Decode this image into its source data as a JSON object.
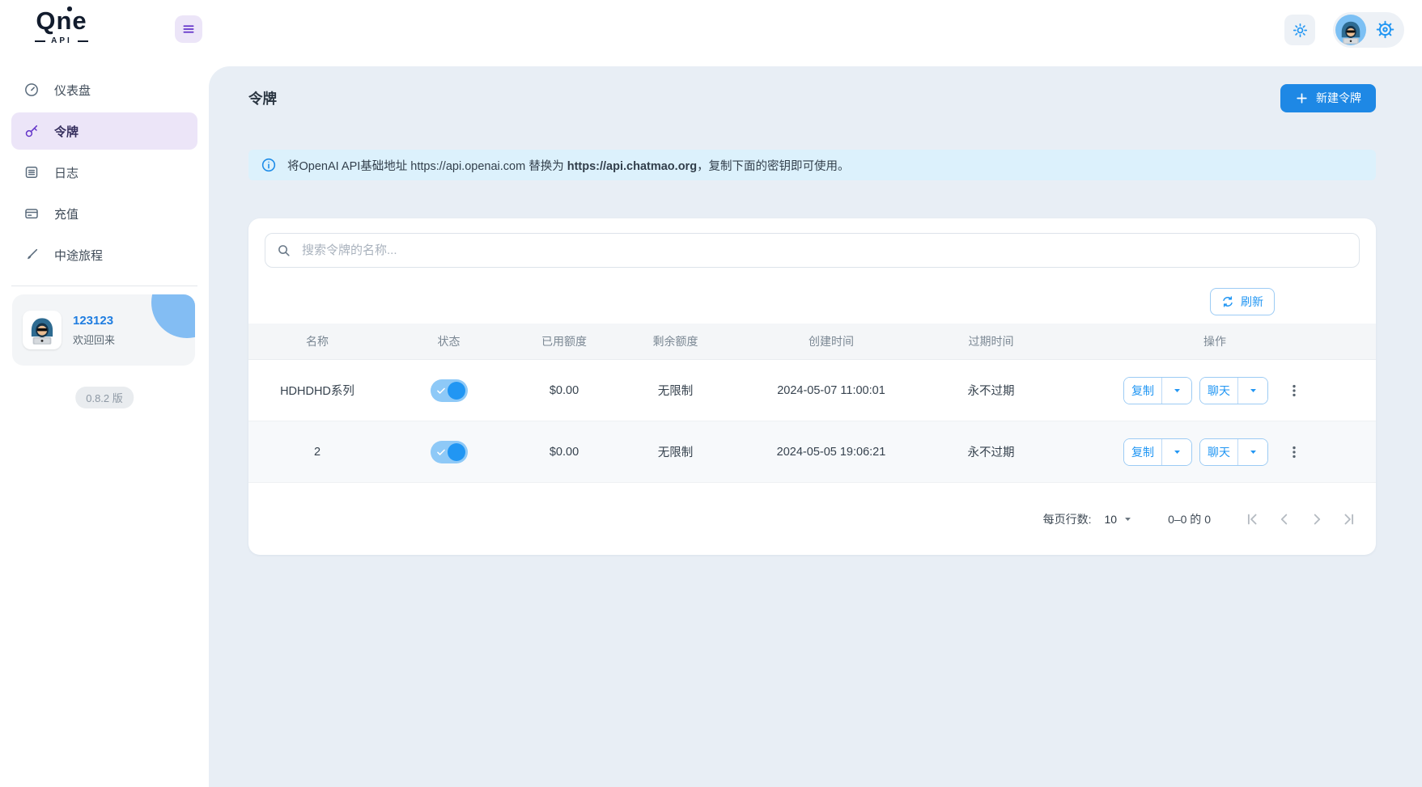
{
  "brand": {
    "logo_text": "Qne",
    "logo_sub": "API"
  },
  "sidebar": {
    "items": [
      {
        "key": "dashboard",
        "label": "仪表盘",
        "icon": "dashboard-icon",
        "active": false
      },
      {
        "key": "tokens",
        "label": "令牌",
        "icon": "key-icon",
        "active": true
      },
      {
        "key": "logs",
        "label": "日志",
        "icon": "logs-icon",
        "active": false
      },
      {
        "key": "recharge",
        "label": "充值",
        "icon": "credit-card-icon",
        "active": false
      },
      {
        "key": "midjourney",
        "label": "中途旅程",
        "icon": "paintbrush-icon",
        "active": false
      }
    ],
    "user": {
      "name": "123123",
      "greeting": "欢迎回来"
    },
    "version": "0.8.2 版"
  },
  "page": {
    "title": "令牌",
    "new_token_button": "新建令牌",
    "notice_prefix": "将OpenAI API基础地址 https://api.openai.com 替换为 ",
    "notice_bold": "https://api.chatmao.org",
    "notice_suffix": "，复制下面的密钥即可使用。"
  },
  "toolbar": {
    "search_placeholder": "搜索令牌的名称...",
    "refresh_label": "刷新"
  },
  "table": {
    "headers": [
      "名称",
      "状态",
      "已用额度",
      "剩余额度",
      "创建时间",
      "过期时间",
      "操作"
    ],
    "action_copy": "复制",
    "action_chat": "聊天",
    "rows": [
      {
        "name": "HDHDHD系列",
        "enabled": true,
        "used": "$0.00",
        "remaining": "无限制",
        "created": "2024-05-07 11:00:01",
        "expires": "永不过期"
      },
      {
        "name": "2",
        "enabled": true,
        "used": "$0.00",
        "remaining": "无限制",
        "created": "2024-05-05 19:06:21",
        "expires": "永不过期"
      }
    ]
  },
  "pagination": {
    "rows_per_page_label": "每页行数:",
    "rows_per_page_value": "10",
    "range_text": "0–0 的 0"
  },
  "colors": {
    "accent_blue": "#2196f3",
    "accent_purple": "#6435c9",
    "panel_bg": "#e8eef5",
    "notice_bg": "#dcf1fc",
    "toggle_track": "#8ec9f7"
  }
}
